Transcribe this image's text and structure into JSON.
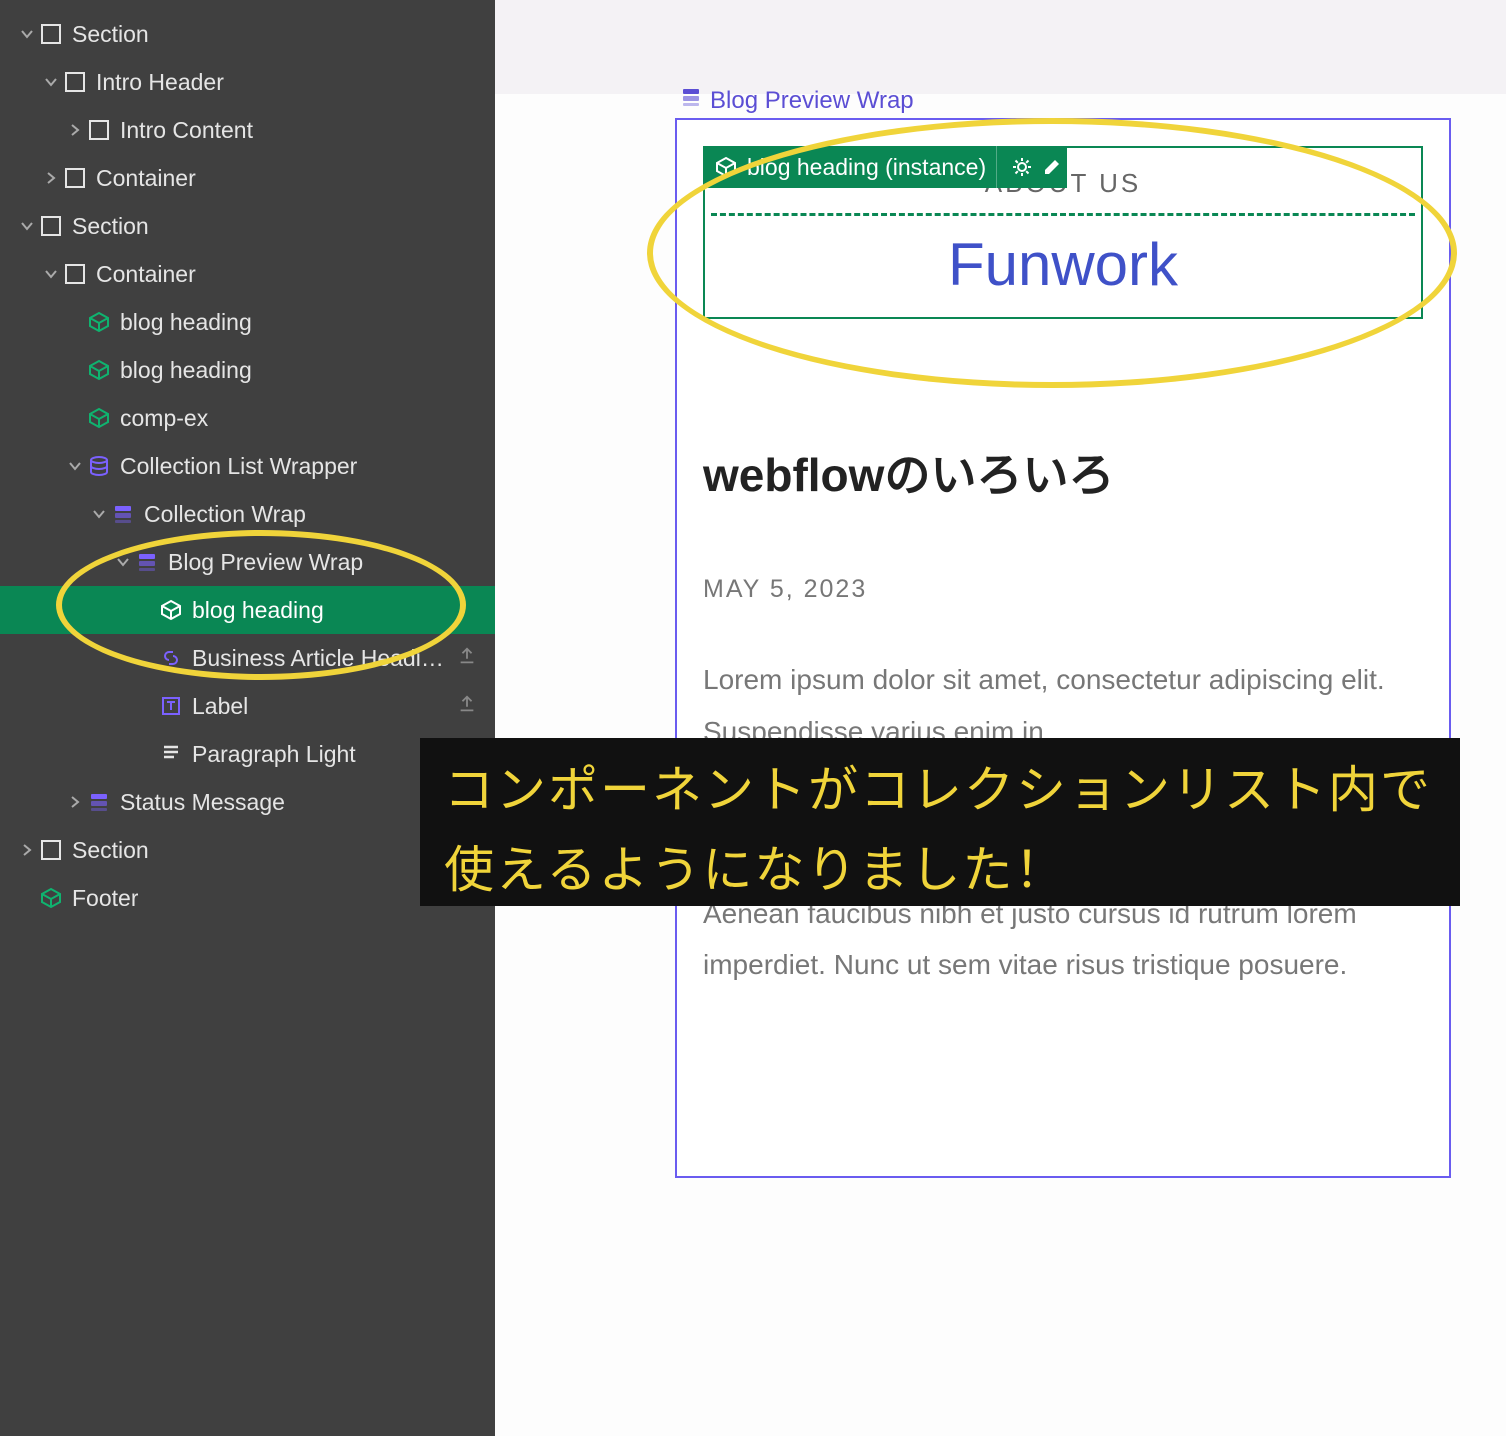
{
  "tree": {
    "section1": "Section",
    "intro_header": "Intro Header",
    "intro_content": "Intro Content",
    "container1": "Container",
    "section2": "Section",
    "container2": "Container",
    "blog_heading_a": "blog heading",
    "blog_heading_b": "blog heading",
    "comp_ex": "comp-ex",
    "cl_wrapper": "Collection List Wrapper",
    "coll_wrap": "Collection Wrap",
    "blog_preview_wrap": "Blog Preview Wrap",
    "blog_heading_sel": "blog heading",
    "biz_heading": "Business Article Headi…",
    "label": "Label",
    "para_light": "Paragraph Light",
    "status_msg": "Status Message",
    "section3": "Section",
    "footer": "Footer"
  },
  "canvas": {
    "breadcrumb": "Blog Preview Wrap",
    "instance_tag": "blog heading (instance)",
    "about_label": "ABOUT US",
    "about_headline": "Funwork",
    "article_title": "webflowのいろいろ",
    "article_date": "MAY 5, 2023",
    "article_p1": "Lorem ipsum dolor sit amet, consectetur adipiscing elit. Suspendisse varius enim in",
    "article_p2": "Aenean faucibus nibh et justo cursus id rutrum lorem imperdiet. Nunc ut sem vitae risus tristique posuere."
  },
  "annotation": "コンポーネントがコレクションリスト内で使えるようになりました！"
}
